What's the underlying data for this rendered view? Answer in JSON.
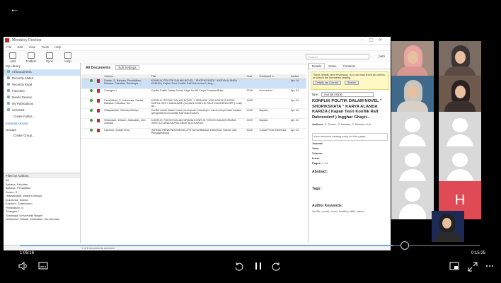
{
  "player": {
    "back_glyph": "←",
    "current_time": "1:05:16",
    "remaining_time": "0:15:25",
    "progress_fraction": 0.81
  },
  "mendeley": {
    "window_title": "Mendeley Desktop",
    "menu": [
      "File",
      "Edit",
      "View",
      "Tools",
      "Help"
    ],
    "toolbar": {
      "add": "Add",
      "folders": "Folders",
      "sync": "Sync",
      "help": "Help"
    },
    "search_placeholder": "Search",
    "user_label": "putri",
    "library_header": "My Library",
    "library_items": [
      "All Documents",
      "Recently Added",
      "Recently Read",
      "Favorites",
      "Needs Review",
      "My Publications",
      "Unsorted"
    ],
    "create_folder": "Create Folder...",
    "external_library": "External Library",
    "groups": "Groups",
    "create_group": "Create Group...",
    "filter_header": "Filter by Authors",
    "filter_items": [
      "All",
      "Bahasa, Fakultas",
      "Bahasa, Pendidikan",
      "Dosen, S.",
      "Hidayatullah, Mandra Wahyu",
      "Indonesia, Sastra",
      "Kasnum, Suharnomo",
      "Pendidikan, S.",
      "Suangka, I",
      "Surabaya, Universitas Negeri",
      "Wulandari, Wiskar, Jalaluddin, Zen Amrallu"
    ],
    "center_title": "All Documents",
    "edit_settings": "Edit Settings",
    "columns": [
      "Authors",
      "Title",
      "Year",
      "Published In",
      "Added"
    ],
    "rows": [
      {
        "authors": "Dosen, S; Bahasa, Pendidikan; Bahasa, Fakultas; Surabaya,...",
        "title": "KONFLIK POLITIK DALAM NOVEL \" SHOPIKSHATA \" KARYA ALANDA KARIZA ( Kajian Teori Konflik Ralf Dahrendorf ) Ang...",
        "year": "",
        "published": "",
        "added": "Apr 24"
      },
      {
        "authors": "Suangka, I",
        "title": "Konflik Politik Dalam Novel Saga No 89 Karya Pustaka Bhita",
        "year": "2018",
        "published": "Humaniora",
        "added": "Apr 24"
      },
      {
        "authors": "Pendidikan, S; Indonesia, Sastra; Bahasa, Fakultas; Sa...",
        "title": "KONFLIK SOSIAL DALAM NOVEL 1 SEBAGAI 1000 KAKINYA DOSA KARYA OKKY MADASARI (KAJIAN KONFLIK RALF DAHRENDORF ) Lusiy An...",
        "year": "1998",
        "published": "",
        "added": "Apr 24"
      },
      {
        "authors": "Hidayatullah, Mandra Wahyu",
        "title": "Konflik sosial dalam novel perempuan bersampur merah karya intan Andaru (perspektif teori konflik Ralf Dahrendorf)",
        "year": "2018",
        "published": "Bapala",
        "added": "Apr 24"
      },
      {
        "authors": "Wulandari, Wiskar; Jalaluddin; Zen Amrallu",
        "title": "KONFLIK TOKOH DALAM DRAMA KONFLIK TOKOH DALAM DRAMA JOKO LELANA KARYA GEDE SUCHARSO",
        "year": "2019",
        "published": "Bapala",
        "added": "Apr 24"
      },
      {
        "authors": "Kasnum, Suharnomo",
        "title": "JURNAL PENA INDONESIA (JPI) Jurnal Bahasa Indonesia, Sastra, dan Pengajarannya",
        "year": "2015",
        "published": "Jurnal Pena Indonesia",
        "added": "Apr 24"
      }
    ],
    "details_tabs": [
      "Details",
      "Notes",
      "Contents"
    ],
    "note_text": "These details need reviewing. You can mark them as correct, or search the Mendeley catalog.",
    "note_btn1": "Details are Correct",
    "note_btn2": "Search",
    "type_label": "Type:",
    "type_value": "Journal Article",
    "doc_title": "KONFLIK POLITIK DALAM NOVEL \" SHOPIKSHATA \" KARYA ALANDA KARIZA ( Kajian Teori Konflik Ralf Dahrendorf ) Ingghar Ghayit...",
    "authors_label": "Authors:",
    "authors_value": "S. Dosen, P. Bahasa, F. Bahasa et al.",
    "view_catalog": "View research catalog entry for this paper",
    "fields": [
      {
        "k": "Journal:",
        "v": ""
      },
      {
        "k": "Year:",
        "v": ""
      },
      {
        "k": "Volume:",
        "v": ""
      },
      {
        "k": "Issue:",
        "v": ""
      },
      {
        "k": "Pages:",
        "v": "1-14"
      }
    ],
    "abstract": "Abstract:",
    "tags": "Tags:",
    "author_keywords": "Author Keywords:",
    "keywords_value": "konflik; sosial; novel; konflik politik; sastra",
    "statusbar": "1 of 6 documents selected"
  },
  "participants": {
    "h_initial": "H"
  },
  "icons": [
    "back-arrow-icon",
    "volume-icon",
    "subtitles-icon",
    "rewind-10-icon",
    "pause-icon",
    "forward-30-icon",
    "picture-in-picture-icon",
    "fullscreen-icon",
    "more-icon"
  ]
}
